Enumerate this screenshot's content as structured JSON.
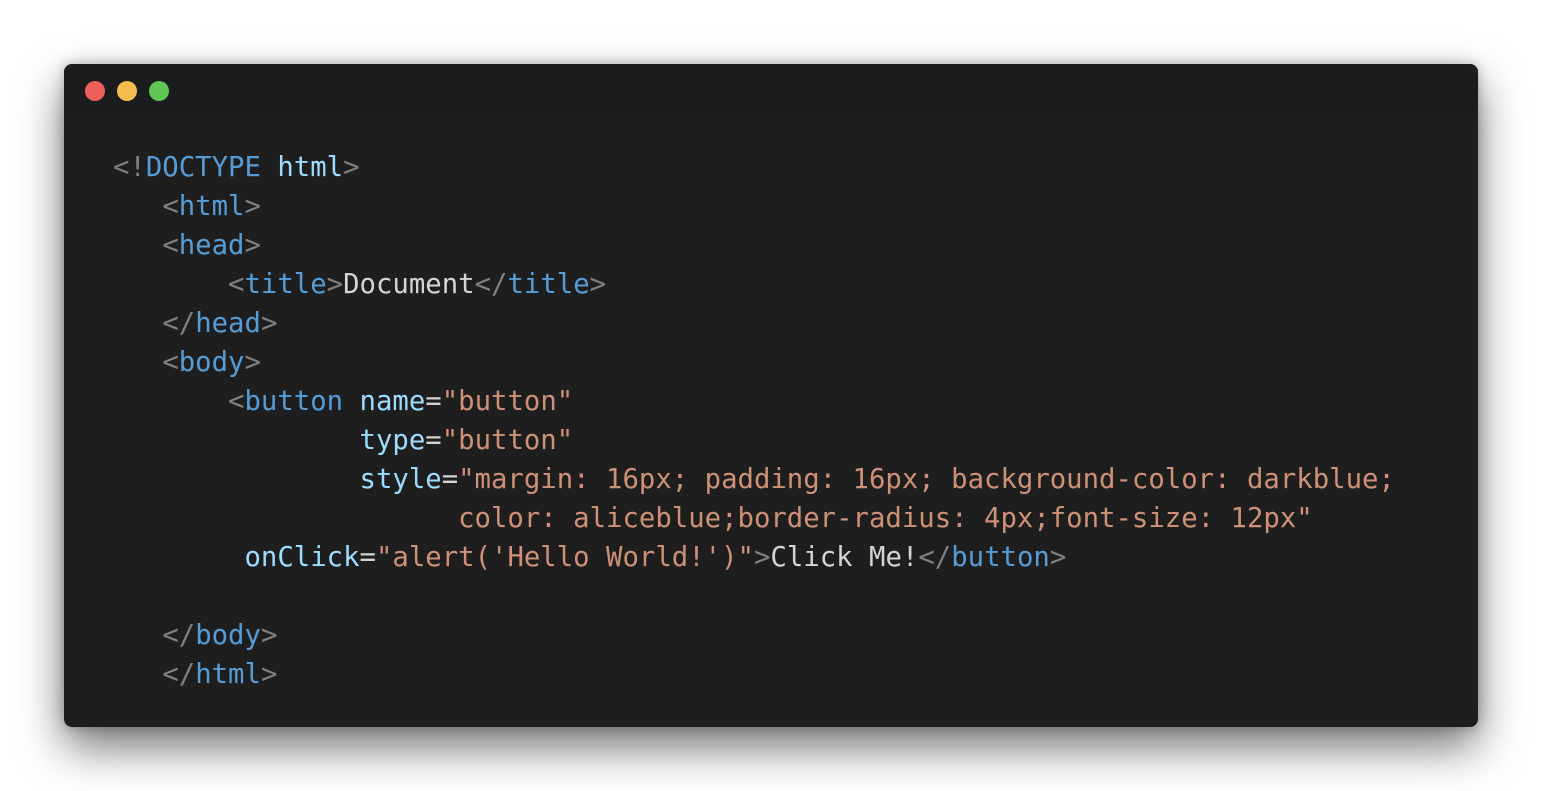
{
  "window": {
    "buttons": [
      {
        "name": "close",
        "color": "#ee5f5b"
      },
      {
        "name": "minimize",
        "color": "#f5bd4f"
      },
      {
        "name": "maximize",
        "color": "#62c654"
      }
    ]
  },
  "theme": {
    "punct": "#808080",
    "tag": "#569cd6",
    "attr": "#9cdcfe",
    "string": "#ce9178",
    "text": "#d4d4d4"
  },
  "code_lines": [
    [
      [
        "punct",
        "<!"
      ],
      [
        "tag",
        "DOCTYPE"
      ],
      [
        "text",
        " "
      ],
      [
        "attr",
        "html"
      ],
      [
        "punct",
        ">"
      ]
    ],
    [
      [
        "text",
        "   "
      ],
      [
        "punct",
        "<"
      ],
      [
        "tag",
        "html"
      ],
      [
        "punct",
        ">"
      ]
    ],
    [
      [
        "text",
        "   "
      ],
      [
        "punct",
        "<"
      ],
      [
        "tag",
        "head"
      ],
      [
        "punct",
        ">"
      ]
    ],
    [
      [
        "text",
        "       "
      ],
      [
        "punct",
        "<"
      ],
      [
        "tag",
        "title"
      ],
      [
        "punct",
        ">"
      ],
      [
        "text",
        "Document"
      ],
      [
        "punct",
        "</"
      ],
      [
        "tag",
        "title"
      ],
      [
        "punct",
        ">"
      ]
    ],
    [
      [
        "text",
        "   "
      ],
      [
        "punct",
        "</"
      ],
      [
        "tag",
        "head"
      ],
      [
        "punct",
        ">"
      ]
    ],
    [
      [
        "text",
        "   "
      ],
      [
        "punct",
        "<"
      ],
      [
        "tag",
        "body"
      ],
      [
        "punct",
        ">"
      ]
    ],
    [
      [
        "text",
        "       "
      ],
      [
        "punct",
        "<"
      ],
      [
        "tag",
        "button"
      ],
      [
        "text",
        " "
      ],
      [
        "attr",
        "name"
      ],
      [
        "text",
        "="
      ],
      [
        "string",
        "\"button\""
      ]
    ],
    [
      [
        "text",
        "               "
      ],
      [
        "attr",
        "type"
      ],
      [
        "text",
        "="
      ],
      [
        "string",
        "\"button\""
      ]
    ],
    [
      [
        "text",
        "               "
      ],
      [
        "attr",
        "style"
      ],
      [
        "text",
        "="
      ],
      [
        "string",
        "\"margin: 16px; padding: 16px; background-color: darkblue;"
      ]
    ],
    [
      [
        "text",
        "                     "
      ],
      [
        "string",
        "color: aliceblue;border-radius: 4px;font-size: 12px\""
      ]
    ],
    [
      [
        "text",
        "        "
      ],
      [
        "attr",
        "onClick"
      ],
      [
        "text",
        "="
      ],
      [
        "string",
        "\"alert('Hello World!')\""
      ],
      [
        "punct",
        ">"
      ],
      [
        "text",
        "Click Me!"
      ],
      [
        "punct",
        "</"
      ],
      [
        "tag",
        "button"
      ],
      [
        "punct",
        ">"
      ]
    ],
    [],
    [
      [
        "text",
        "   "
      ],
      [
        "punct",
        "</"
      ],
      [
        "tag",
        "body"
      ],
      [
        "punct",
        ">"
      ]
    ],
    [
      [
        "text",
        "   "
      ],
      [
        "punct",
        "</"
      ],
      [
        "tag",
        "html"
      ],
      [
        "punct",
        ">"
      ]
    ]
  ]
}
